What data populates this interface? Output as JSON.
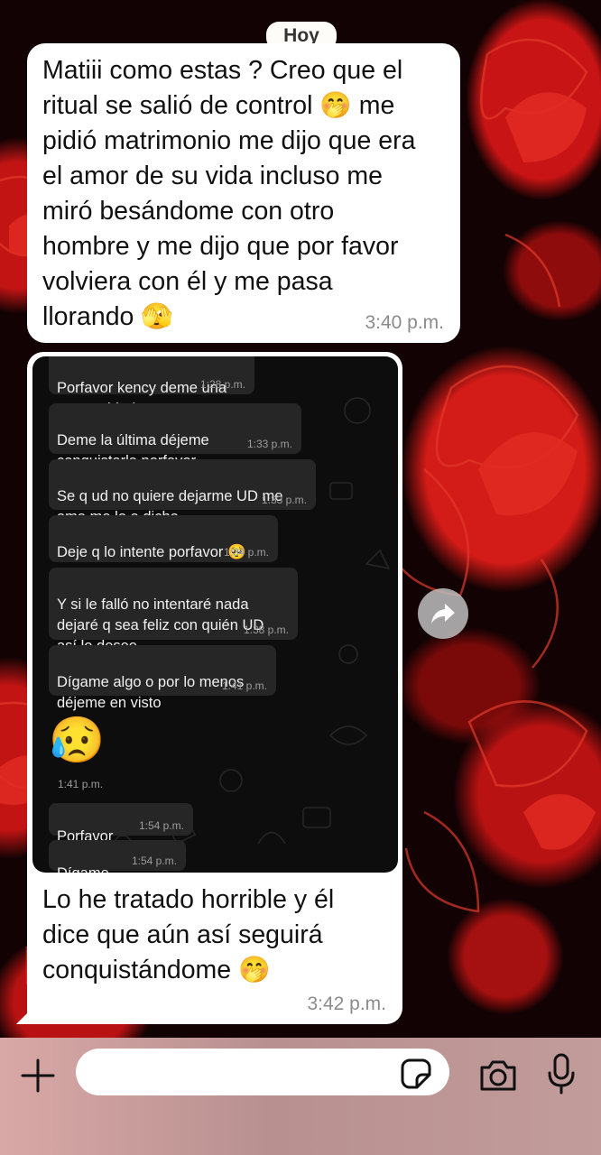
{
  "date_chip": "Hoy",
  "messages": [
    {
      "text": "Matiii como estas ? Creo que el\nritual se salió de control 🤭 me\npidió matrimonio me dijo que era\nel amor de su vida incluso me\nmiró besándome con otro\nhombre y me dijo que por favor\nvolviera con él y me pasa\nllorando 🫣",
      "time": "3:40 p.m."
    },
    {
      "text": "Lo he tratado horrible y él\ndice que aún así seguirá\nconquistándome 🤭",
      "time": "3:42 p.m."
    }
  ],
  "embedded_screenshot": {
    "messages": [
      {
        "text": "Porfavor kency deme una\noportunidad",
        "time": "1:28 p.m."
      },
      {
        "text": "Deme la última déjeme\nconquistarla porfavor",
        "time": "1:33 p.m."
      },
      {
        "text": "Se q ud no quiere dejarme UD me\nama me lo a dicho",
        "time": "1:33 p.m."
      },
      {
        "text": "Deje q lo intente porfavor 🥺",
        "time": "1:34 p.m."
      },
      {
        "text": "Y si le falló no intentaré nada\ndejaré q sea feliz con quién UD\nasí lo desee",
        "time": "1:38 p.m."
      },
      {
        "text": "Dígame algo o por lo menos\ndéjeme en visto",
        "time": "1:41 p.m."
      },
      {
        "emoji": "😥",
        "time": "1:41 p.m."
      },
      {
        "text": "Porfavor",
        "time": "1:54 p.m."
      },
      {
        "text": "Dígame",
        "time": "1:54 p.m."
      }
    ]
  },
  "icons": {
    "forward": "forward-icon",
    "plus": "plus-icon",
    "sticker": "sticker-icon",
    "camera": "camera-icon",
    "mic": "mic-icon"
  },
  "colors": {
    "bubble": "#ffffff",
    "embedded_bg": "#0d0d0d",
    "embedded_bubble": "#262626",
    "wallpaper_red": "#c81414"
  },
  "input": {
    "value": "",
    "placeholder": ""
  }
}
